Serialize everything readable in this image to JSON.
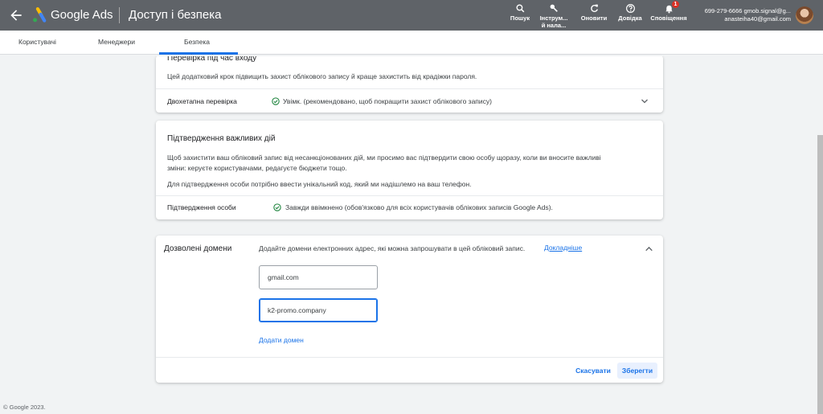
{
  "header": {
    "brand": "Google Ads",
    "page_title": "Доступ і безпека",
    "tools": [
      {
        "label": "Пошук",
        "icon": "search-icon"
      },
      {
        "label1": "Інструм...",
        "label2": "й нала...",
        "icon": "wrench-icon"
      },
      {
        "label": "Оновити",
        "icon": "refresh-icon"
      },
      {
        "label": "Довідка",
        "icon": "help-icon"
      },
      {
        "label": "Сповіщення",
        "icon": "bell-icon",
        "badge": "1"
      }
    ],
    "account": {
      "line1": "699-279-6666 gmob.signal@g...",
      "line2": "anasteiha40@gmail.com"
    }
  },
  "tabs": [
    "Користувачі",
    "Менеджери",
    "Безпека"
  ],
  "active_tab": "Безпека",
  "login_check": {
    "title": "Перевірка під час входу",
    "description": "Цей додатковий крок підвищить захист облікового запису й краще захистить від крадіжки пароля.",
    "row_label": "Двохетапна перевірка",
    "row_status": "Увімк. (рекомендовано, щоб покращити захист облікового запису)"
  },
  "important_actions": {
    "title": "Підтвердження важливих дій",
    "description1": "Щоб захистити ваш обліковий запис від несанкціонованих дій, ми просимо вас підтвердити свою особу щоразу, коли ви вносите важливі",
    "description2": "зміни: керуєте користувачами, редагуєте бюджети тощо.",
    "description3": "Для підтвердження особи потрібно ввести унікальний код, який ми надішлемо на ваш телефон.",
    "row_label": "Підтвердження особи",
    "row_status": "Завжди ввімкнено (обов'язково для всіх користувачів облікових записів Google Ads)."
  },
  "allowed_domains": {
    "title": "Дозволені домени",
    "description": "Додайте домени електронних адрес, які можна запрошувати в цей обліковий запис.",
    "learn_more": "Докладніше",
    "domains": [
      "gmail.com",
      "k2-promo.company"
    ],
    "add_domain": "Додати домен",
    "cancel": "Скасувати",
    "save": "Зберегти"
  },
  "footer": "© Google 2023.",
  "colors": {
    "header_bg": "#5f6368",
    "accent": "#1a73e8",
    "success": "#188038"
  }
}
